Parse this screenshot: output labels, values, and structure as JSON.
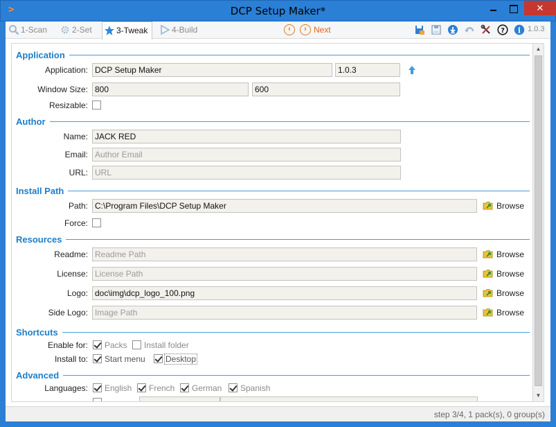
{
  "window": {
    "title": "DCP Setup Maker*",
    "close_glyph": "✕"
  },
  "toolbar": {
    "tabs": [
      {
        "label": "1-Scan",
        "icon": "magnifier-icon"
      },
      {
        "label": "2-Set",
        "icon": "gear-icon"
      },
      {
        "label": "3-Tweak",
        "icon": "star-icon"
      },
      {
        "label": "4-Build",
        "icon": "play-icon"
      }
    ],
    "next_label": "Next",
    "version": "1.0.3"
  },
  "sections": {
    "application": "Application",
    "author": "Author",
    "install_path": "Install Path",
    "resources": "Resources",
    "shortcuts": "Shortcuts",
    "advanced": "Advanced"
  },
  "application": {
    "app_label": "Application:",
    "name": "DCP Setup Maker",
    "version": "1.0.3",
    "window_size_label": "Window Size:",
    "width": "800",
    "height": "600",
    "resizable_label": "Resizable:",
    "resizable": false
  },
  "author": {
    "name_label": "Name:",
    "name": "JACK RED",
    "email_label": "Email:",
    "email_placeholder": "Author Email",
    "url_label": "URL:",
    "url_placeholder": "URL"
  },
  "install_path": {
    "path_label": "Path:",
    "path": "C:\\Program Files\\DCP Setup Maker",
    "force_label": "Force:",
    "force": false
  },
  "resources": {
    "readme_label": "Readme:",
    "readme_placeholder": "Readme Path",
    "license_label": "License:",
    "license_placeholder": "License Path",
    "logo_label": "Logo:",
    "logo": "doc\\img\\dcp_logo_100.png",
    "side_logo_label": "Side Logo:",
    "side_logo_placeholder": "Image Path"
  },
  "browse_label": "Browse",
  "shortcuts": {
    "enable_for_label": "Enable for:",
    "packs_label": "Packs",
    "packs": true,
    "install_folder_label": "Install folder",
    "install_folder": false,
    "install_to_label": "Install to:",
    "start_menu_label": "Start menu",
    "start_menu": true,
    "desktop_label": "Desktop",
    "desktop": true
  },
  "advanced": {
    "languages_label": "Languages:",
    "languages": [
      {
        "label": "English",
        "checked": true
      },
      {
        "label": "French",
        "checked": true
      },
      {
        "label": "German",
        "checked": true
      },
      {
        "label": "Spanish",
        "checked": true
      }
    ]
  },
  "status": {
    "text": "step 3/4, 1 pack(s), 0 group(s)"
  },
  "colors": {
    "accent": "#1c7ec8",
    "titlebar": "#2b7fd4",
    "close": "#c7372f",
    "next": "#e0661a"
  }
}
